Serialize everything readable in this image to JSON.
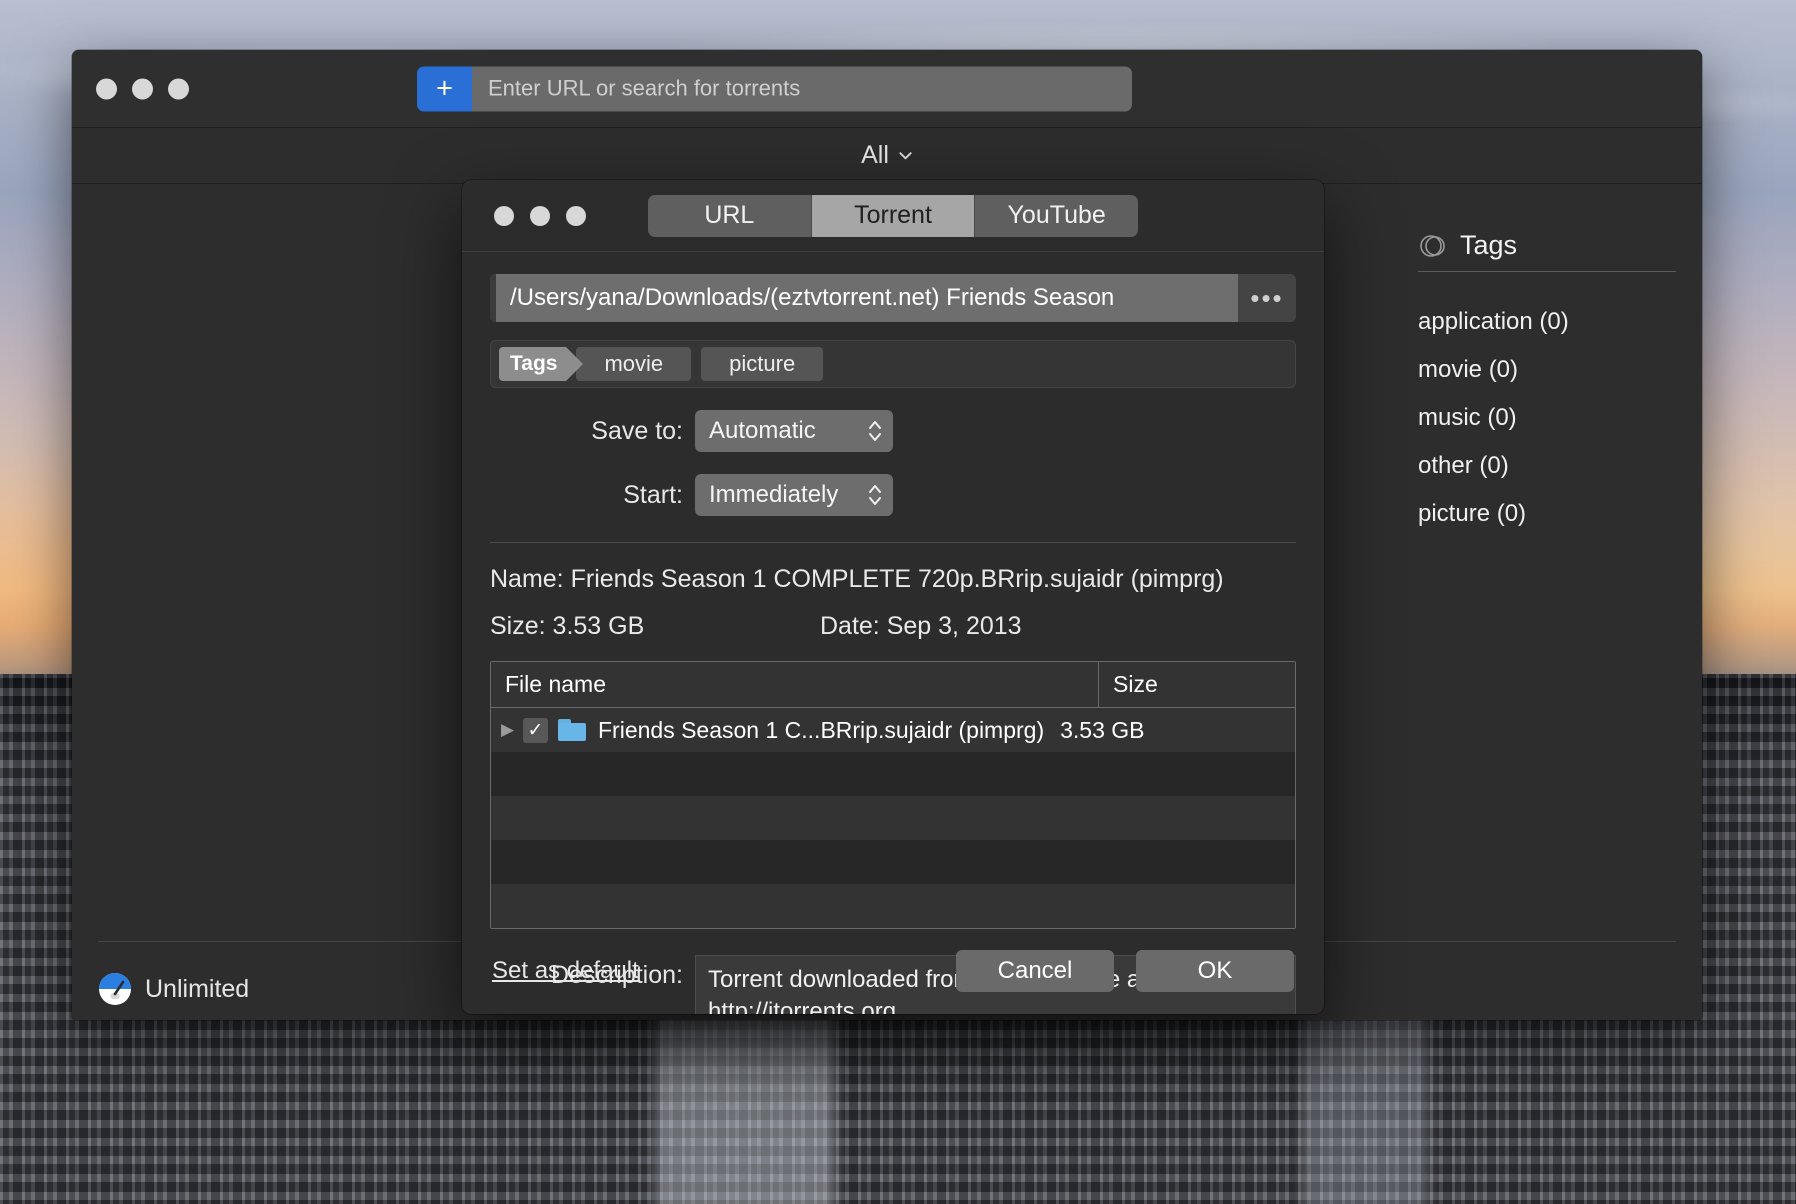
{
  "desktop": {
    "wallpaper_description": "city skyline at sunset"
  },
  "app_window": {
    "titlebar": {
      "plus_label": "+",
      "plus_icon": "plus-icon",
      "search_placeholder": "Enter URL or search for torrents",
      "search_value": ""
    },
    "filter": {
      "label": "All",
      "chevron_icon": "chevron-down-icon"
    },
    "tags_panel": {
      "icon": "tag-circle-icon",
      "title": "Tags",
      "items": [
        {
          "label": "application (0)"
        },
        {
          "label": "movie (0)"
        },
        {
          "label": "music (0)"
        },
        {
          "label": "other (0)"
        },
        {
          "label": "picture (0)"
        }
      ]
    },
    "status_bar": {
      "icon": "speedometer-icon",
      "speed_label": "Unlimited"
    }
  },
  "dialog": {
    "segments": [
      {
        "label": "URL",
        "selected": false
      },
      {
        "label": "Torrent",
        "selected": true
      },
      {
        "label": "YouTube",
        "selected": false
      }
    ],
    "path": {
      "value": "/Users/yana/Downloads/(eztvtorrent.net) Friends Season",
      "browse_label": "•••"
    },
    "tags": {
      "label": "Tags",
      "chips": [
        {
          "label": "movie"
        },
        {
          "label": "picture"
        }
      ]
    },
    "save_to": {
      "label": "Save to:",
      "value": "Automatic"
    },
    "start": {
      "label": "Start:",
      "value": "Immediately"
    },
    "info": {
      "name_label": "Name:",
      "name_value": "Friends Season 1 COMPLETE 720p.BRrip.sujaidr (pimprg)",
      "size_label": "Size:",
      "size_value": "3.53 GB",
      "date_label": "Date:",
      "date_value": "Sep 3, 2013"
    },
    "file_table": {
      "columns": [
        "File name",
        "Size"
      ],
      "rows": [
        {
          "disclosure_icon": "triangle-right-icon",
          "checked": true,
          "check_glyph": "✓",
          "folder_icon": "folder-icon",
          "name": "Friends Season 1 C...BRrip.sujaidr (pimprg)",
          "size": "3.53 GB"
        }
      ],
      "empty_rows": 4
    },
    "description": {
      "label": "Description:",
      "value": "Torrent downloaded from torrent cache at http://itorrents.org"
    },
    "footer": {
      "set_default": "Set as default",
      "cancel": "Cancel",
      "ok": "OK"
    }
  },
  "colors": {
    "accent_blue": "#2a6fd6",
    "window_bg": "#2d2d2d",
    "dialog_bg": "#2c2c2c",
    "segment_selected": "#a6a6a6",
    "folder_blue": "#68b6e8"
  }
}
